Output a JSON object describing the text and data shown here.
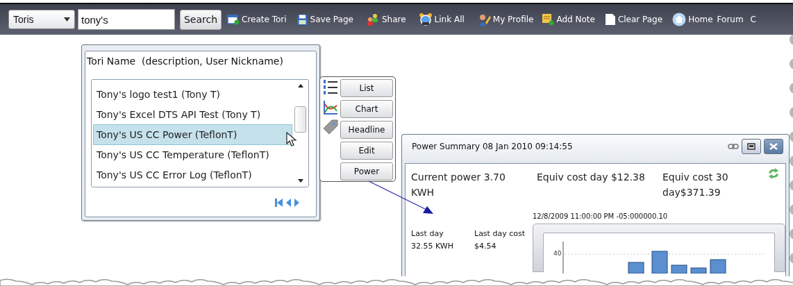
{
  "toolbar": {
    "category": {
      "value": "Toris"
    },
    "search": {
      "value": "tony's"
    },
    "search_button": "Search",
    "items": [
      {
        "label": "Create Tori",
        "kind": "create"
      },
      {
        "label": "Save Page",
        "kind": "save"
      },
      {
        "label": "Share",
        "kind": "share"
      },
      {
        "label": "Link All",
        "kind": "link"
      },
      {
        "label": "My Profile",
        "kind": "profile"
      },
      {
        "label": "Add Note",
        "kind": "note"
      },
      {
        "label": "Clear Page",
        "kind": "clear"
      },
      {
        "label": "Home",
        "kind": "home"
      },
      {
        "label": "Forum",
        "kind": "text"
      },
      {
        "label": "C",
        "kind": "text"
      }
    ]
  },
  "tori_list": {
    "title": "Tori Name  (description, User Nickname)",
    "rows": [
      {
        "label": "Tony's logo test1 (Tony T)",
        "selected": false
      },
      {
        "label": "Tony's Excel DTS API Test (Tony T)",
        "selected": false
      },
      {
        "label": "Tony's US CC Power (TeflonT)",
        "selected": true
      },
      {
        "label": "Tony's US CC Temperature (TeflonT)",
        "selected": false
      },
      {
        "label": "Tony's US CC Error Log (TeflonT)",
        "selected": false
      }
    ]
  },
  "view_buttons": [
    {
      "label": "List",
      "kind": "list"
    },
    {
      "label": "Chart",
      "kind": "chart"
    },
    {
      "label": "Headline",
      "kind": "headline"
    },
    {
      "label": "Edit",
      "kind": "plain"
    },
    {
      "label": "Power",
      "kind": "plain"
    }
  ],
  "power_window": {
    "title": "Power Summary 08 Jan 2010 09:14:55",
    "stats": [
      "Current power 3.70 KWH",
      "Equiv cost day $12.38",
      "Equiv cost 30 day$371.39"
    ],
    "last_day": [
      "Last day 32.55 KWH",
      "Last day cost $4.54"
    ],
    "chart_label": "12/8/2009 11:00:00 PM -05:000000.10",
    "axis_label": "40"
  }
}
